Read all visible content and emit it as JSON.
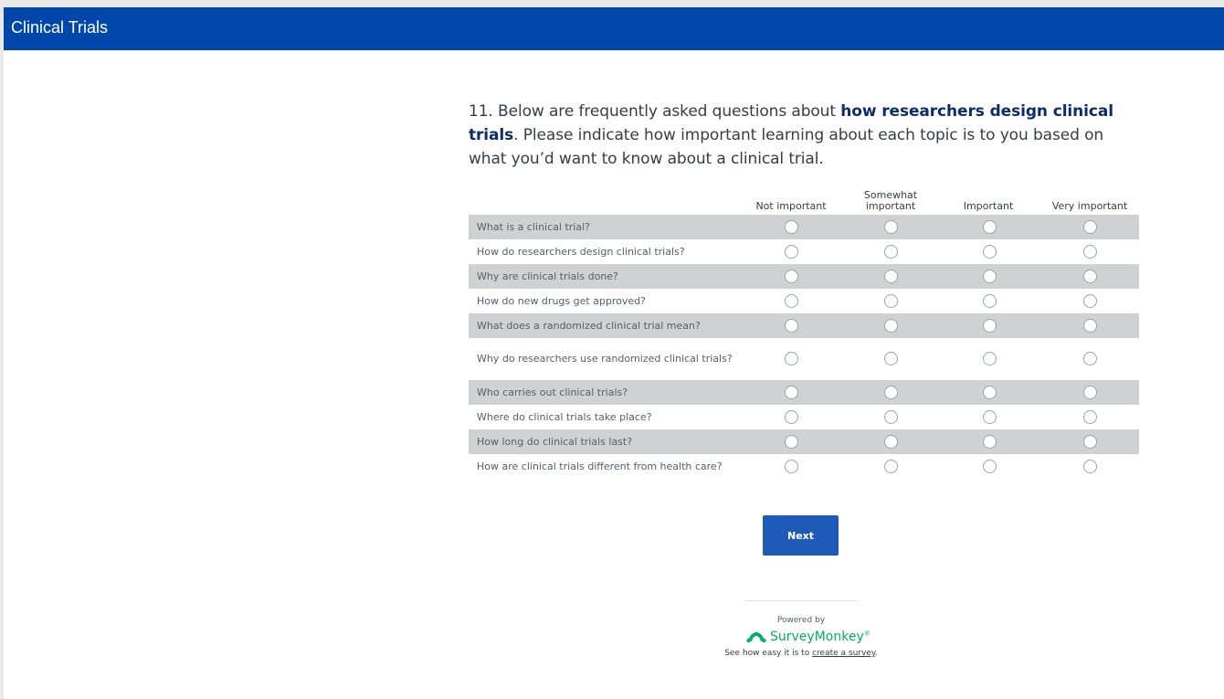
{
  "header": {
    "title": "Clinical Trials"
  },
  "question": {
    "text_before": "11. Below are frequently asked questions about ",
    "text_bold": "how researchers design clinical trials",
    "text_after": ". Please indicate how important learning about each topic is to you based on what you’d want to know about a clinical trial."
  },
  "matrix": {
    "columns": [
      "Not important",
      "Somewhat important",
      "Important",
      "Very important"
    ],
    "rows": [
      "What is a clinical trial?",
      "How do researchers design clinical trials?",
      "Why are clinical trials done?",
      "How do new drugs get approved?",
      "What does a randomized clinical trial mean?",
      "Why do researchers use randomized clinical trials?",
      "Who carries out clinical trials?",
      "Where do clinical trials take place?",
      "How long do clinical trials last?",
      "How are clinical trials different from health care?"
    ]
  },
  "next_button": {
    "label": "Next"
  },
  "footer": {
    "powered_by": "Powered by",
    "brand_name": "SurveyMonkey",
    "brand_tm": "®",
    "see_how_text": "See how easy it is to ",
    "create_link": "create a survey",
    "period": "."
  },
  "colors": {
    "header_bg": "#0047ab",
    "row_shade": "#d0d1d3",
    "button_bg": "#1e5bb8",
    "brand_green": "#00b16a"
  }
}
